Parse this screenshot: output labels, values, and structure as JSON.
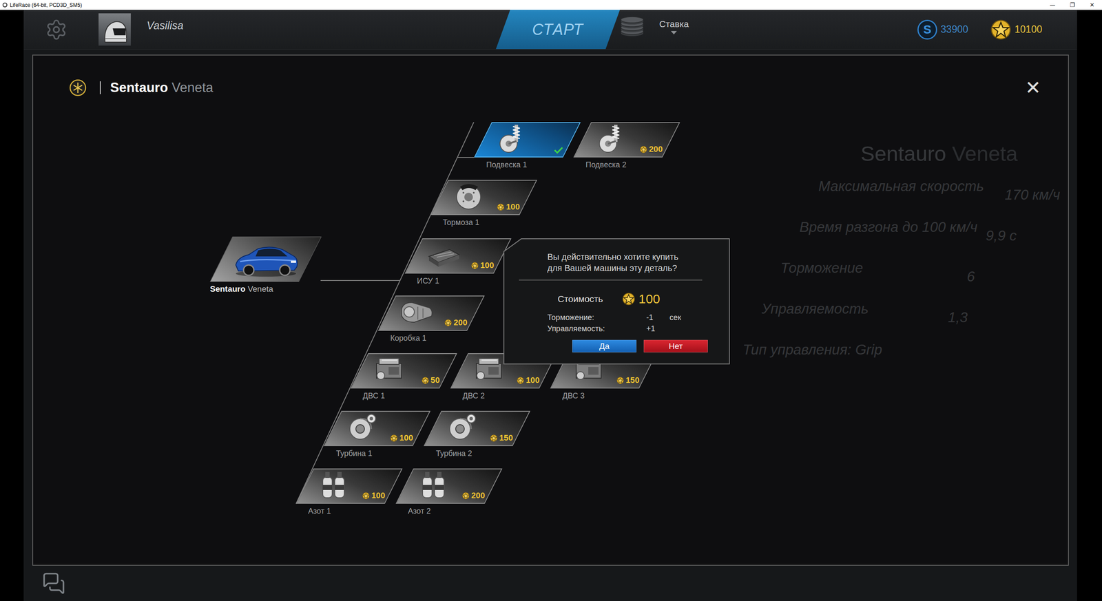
{
  "window": {
    "title": "LifeRace (64-bit, PCD3D_SM5)",
    "controls": [
      "—",
      "❐",
      "✕"
    ]
  },
  "topbar": {
    "player": "Vasilisa",
    "start": "СТАРТ",
    "bet": "Ставка",
    "currencies": [
      {
        "kind": "credits",
        "symbol": "S",
        "amount": "33900"
      },
      {
        "kind": "stars",
        "amount": "10100"
      }
    ]
  },
  "background": {
    "car_title": {
      "make": "Sentauro",
      "model": "Veneta"
    },
    "stats": [
      {
        "label": "Максимальная скорость",
        "value": "170 км/ч"
      },
      {
        "label": "Время разгона до 100 км/ч",
        "value": "9,9 с"
      },
      {
        "label": "Торможение",
        "value": "6"
      },
      {
        "label": "Управляемость",
        "value": "1,3"
      },
      {
        "label": "Тип управления: Grip"
      }
    ]
  },
  "panel": {
    "title": {
      "make": "Sentauro",
      "model": "Veneta"
    },
    "close": "✕",
    "car": {
      "make": "Sentauro",
      "model": "Veneta"
    },
    "parts": [
      {
        "name": "Подвеска 1",
        "kind": "suspension",
        "owned": true,
        "selected": true
      },
      {
        "name": "Подвеска 2",
        "kind": "suspension",
        "price": "200",
        "owned": false,
        "selected": false
      },
      {
        "name": "Тормоза 1",
        "kind": "brakes",
        "price": "100",
        "owned": false,
        "selected": false
      },
      {
        "name": "ИСУ 1",
        "kind": "ecu",
        "price": "100",
        "owned": false,
        "selected": false
      },
      {
        "name": "Коробка 1",
        "kind": "gearbox",
        "price": "200",
        "owned": false,
        "selected": false
      },
      {
        "name": "ДВС 1",
        "kind": "engine",
        "price": "50",
        "owned": false,
        "selected": false
      },
      {
        "name": "ДВС 2",
        "kind": "engine",
        "price": "100",
        "owned": false,
        "selected": false
      },
      {
        "name": "ДВС 3",
        "kind": "engine",
        "price": "150",
        "owned": false,
        "selected": false
      },
      {
        "name": "Турбина 1",
        "kind": "turbo",
        "price": "100",
        "owned": false,
        "selected": false
      },
      {
        "name": "Турбина 2",
        "kind": "turbo",
        "price": "150",
        "owned": false,
        "selected": false
      },
      {
        "name": "Азот 1",
        "kind": "nitro",
        "price": "100",
        "owned": false,
        "selected": false
      },
      {
        "name": "Азот 2",
        "kind": "nitro",
        "price": "200",
        "owned": false,
        "selected": false
      }
    ]
  },
  "dialog": {
    "lines": [
      "Вы действительно хотите купить",
      "для Вашей машины эту деталь?"
    ],
    "cost_label": "Стоимость",
    "cost": "100",
    "effects": [
      {
        "label": "Торможение:",
        "value": "-1",
        "unit": "сек"
      },
      {
        "label": "Управляемость:",
        "value": "+1"
      }
    ],
    "buttons": [
      {
        "label": "Да",
        "kind": "confirm"
      },
      {
        "label": "Нет",
        "kind": "cancel"
      }
    ]
  }
}
